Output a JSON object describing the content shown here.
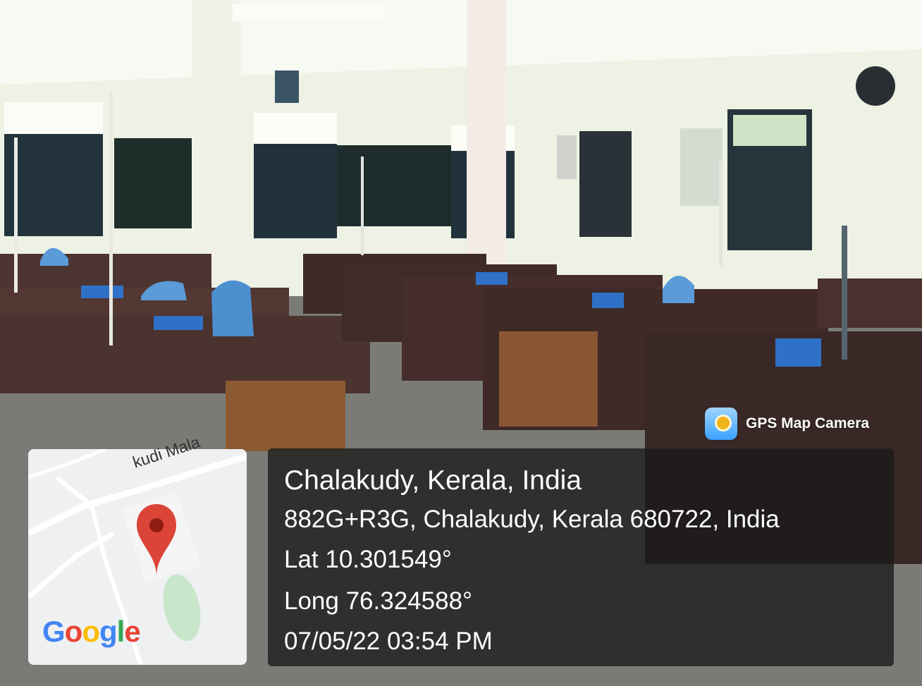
{
  "overlay": {
    "app_badge": {
      "icon": "gps-map-camera-icon",
      "label": "GPS Map Camera"
    },
    "map": {
      "street_label": "kudi Mala",
      "logo_text": "Google",
      "pin_icon": "location-pin-icon",
      "pin_color": "#db4437"
    },
    "location": {
      "place": "Chalakudy, Kerala, India",
      "address": "882G+R3G, Chalakudy, Kerala 680722, India",
      "latitude": "Lat 10.301549°",
      "longitude": "Long 76.324588°",
      "timestamp": "07/05/22 03:54 PM"
    }
  }
}
